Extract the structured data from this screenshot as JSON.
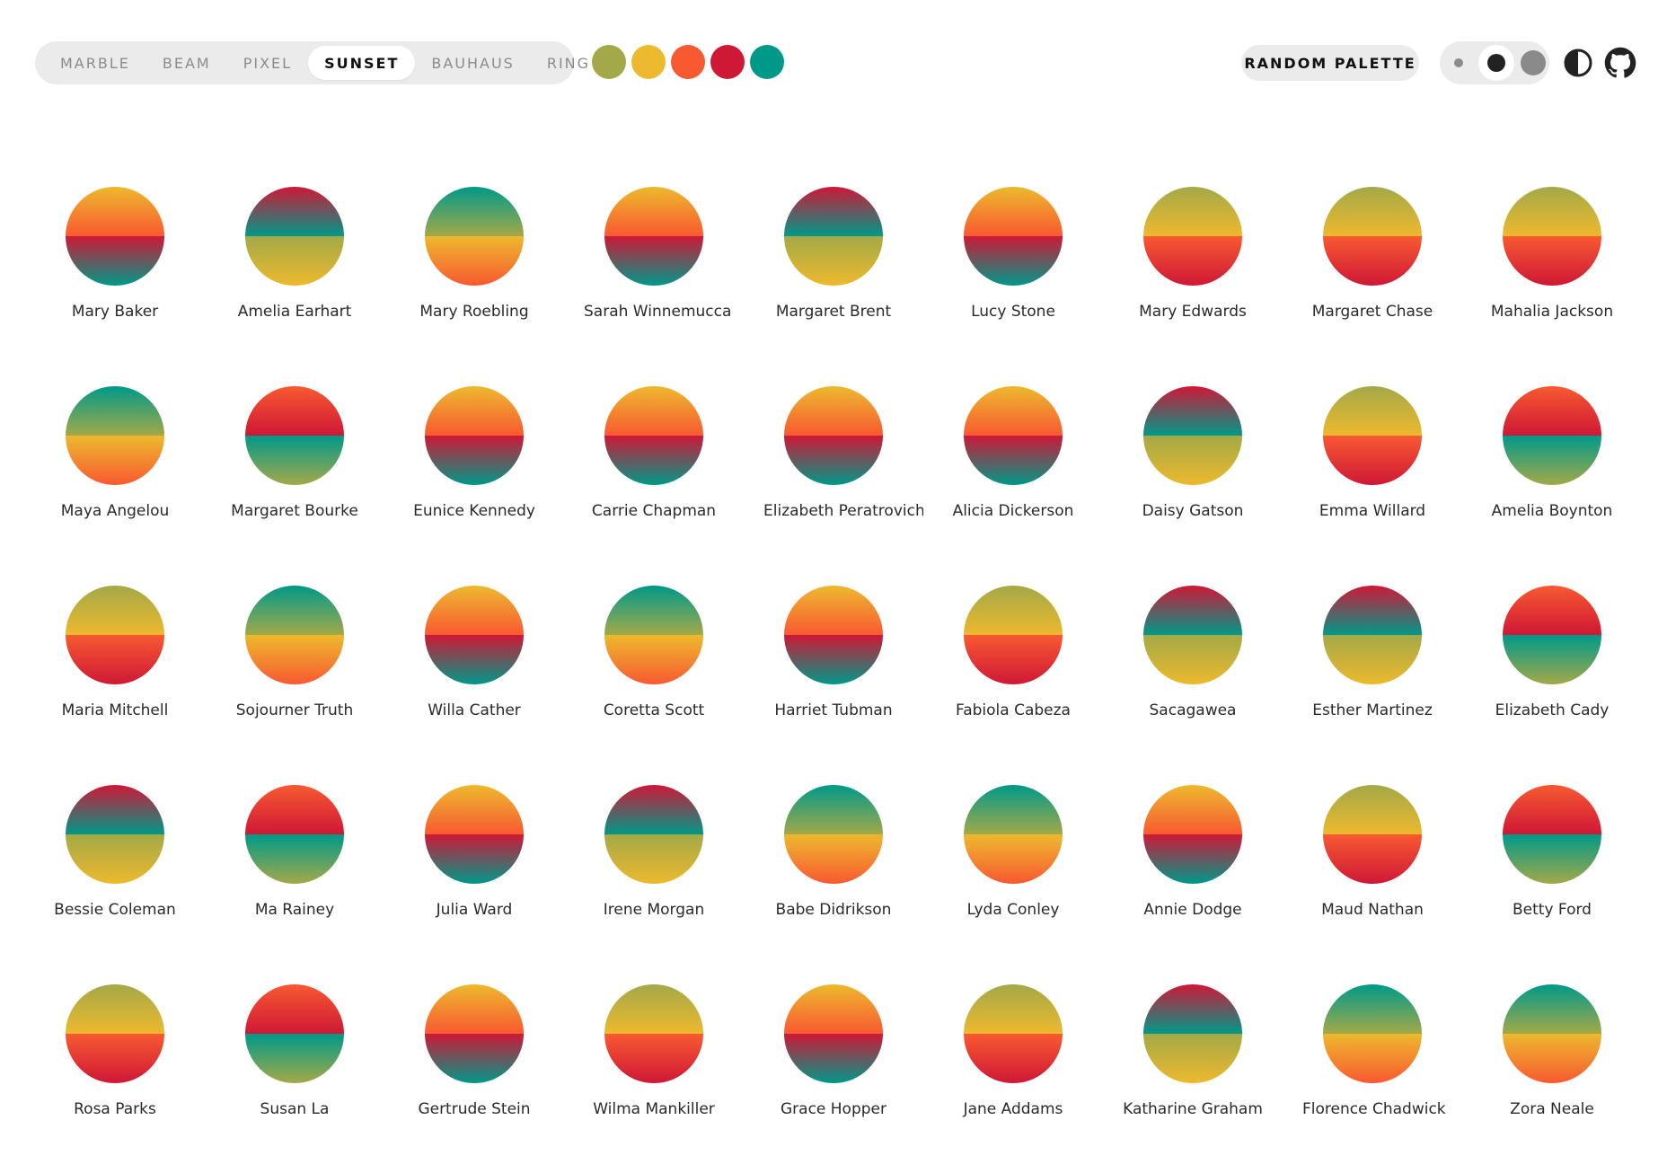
{
  "variants": [
    {
      "label": "MARBLE",
      "active": false
    },
    {
      "label": "BEAM",
      "active": false
    },
    {
      "label": "PIXEL",
      "active": false
    },
    {
      "label": "SUNSET",
      "active": true
    },
    {
      "label": "BAUHAUS",
      "active": false
    },
    {
      "label": "RING",
      "active": false
    }
  ],
  "palette": [
    "#a3a948",
    "#edb92e",
    "#f85931",
    "#ce1836",
    "#009989"
  ],
  "random_label": "RANDOM PALETTE",
  "size_options": [
    "small",
    "medium",
    "large"
  ],
  "selected_size": "medium",
  "icons": {
    "contrast": "contrast-icon",
    "github": "github-icon"
  },
  "avatars": [
    {
      "name": "Mary Baker",
      "top": [
        "#edb92e",
        "#f85931"
      ],
      "bottom": [
        "#ce1836",
        "#009989"
      ]
    },
    {
      "name": "Amelia Earhart",
      "top": [
        "#ce1836",
        "#009989"
      ],
      "bottom": [
        "#a3a948",
        "#edb92e"
      ]
    },
    {
      "name": "Mary Roebling",
      "top": [
        "#009989",
        "#a3a948"
      ],
      "bottom": [
        "#edb92e",
        "#f85931"
      ]
    },
    {
      "name": "Sarah Winnemucca",
      "top": [
        "#edb92e",
        "#f85931"
      ],
      "bottom": [
        "#ce1836",
        "#009989"
      ]
    },
    {
      "name": "Margaret Brent",
      "top": [
        "#ce1836",
        "#009989"
      ],
      "bottom": [
        "#a3a948",
        "#edb92e"
      ]
    },
    {
      "name": "Lucy Stone",
      "top": [
        "#edb92e",
        "#f85931"
      ],
      "bottom": [
        "#ce1836",
        "#009989"
      ]
    },
    {
      "name": "Mary Edwards",
      "top": [
        "#a3a948",
        "#edb92e"
      ],
      "bottom": [
        "#f85931",
        "#ce1836"
      ]
    },
    {
      "name": "Margaret Chase",
      "top": [
        "#a3a948",
        "#edb92e"
      ],
      "bottom": [
        "#f85931",
        "#ce1836"
      ]
    },
    {
      "name": "Mahalia Jackson",
      "top": [
        "#a3a948",
        "#edb92e"
      ],
      "bottom": [
        "#f85931",
        "#ce1836"
      ]
    },
    {
      "name": "Maya Angelou",
      "top": [
        "#009989",
        "#a3a948"
      ],
      "bottom": [
        "#edb92e",
        "#f85931"
      ]
    },
    {
      "name": "Margaret Bourke",
      "top": [
        "#f85931",
        "#ce1836"
      ],
      "bottom": [
        "#009989",
        "#a3a948"
      ]
    },
    {
      "name": "Eunice Kennedy",
      "top": [
        "#edb92e",
        "#f85931"
      ],
      "bottom": [
        "#ce1836",
        "#009989"
      ]
    },
    {
      "name": "Carrie Chapman",
      "top": [
        "#edb92e",
        "#f85931"
      ],
      "bottom": [
        "#ce1836",
        "#009989"
      ]
    },
    {
      "name": "Elizabeth Peratrovich",
      "top": [
        "#edb92e",
        "#f85931"
      ],
      "bottom": [
        "#ce1836",
        "#009989"
      ]
    },
    {
      "name": "Alicia Dickerson",
      "top": [
        "#edb92e",
        "#f85931"
      ],
      "bottom": [
        "#ce1836",
        "#009989"
      ]
    },
    {
      "name": "Daisy Gatson",
      "top": [
        "#ce1836",
        "#009989"
      ],
      "bottom": [
        "#a3a948",
        "#edb92e"
      ]
    },
    {
      "name": "Emma Willard",
      "top": [
        "#a3a948",
        "#edb92e"
      ],
      "bottom": [
        "#f85931",
        "#ce1836"
      ]
    },
    {
      "name": "Amelia Boynton",
      "top": [
        "#f85931",
        "#ce1836"
      ],
      "bottom": [
        "#009989",
        "#a3a948"
      ]
    },
    {
      "name": "Maria Mitchell",
      "top": [
        "#a3a948",
        "#edb92e"
      ],
      "bottom": [
        "#f85931",
        "#ce1836"
      ]
    },
    {
      "name": "Sojourner Truth",
      "top": [
        "#009989",
        "#a3a948"
      ],
      "bottom": [
        "#edb92e",
        "#f85931"
      ]
    },
    {
      "name": "Willa Cather",
      "top": [
        "#edb92e",
        "#f85931"
      ],
      "bottom": [
        "#ce1836",
        "#009989"
      ]
    },
    {
      "name": "Coretta Scott",
      "top": [
        "#009989",
        "#a3a948"
      ],
      "bottom": [
        "#edb92e",
        "#f85931"
      ]
    },
    {
      "name": "Harriet Tubman",
      "top": [
        "#edb92e",
        "#f85931"
      ],
      "bottom": [
        "#ce1836",
        "#009989"
      ]
    },
    {
      "name": "Fabiola Cabeza",
      "top": [
        "#a3a948",
        "#edb92e"
      ],
      "bottom": [
        "#f85931",
        "#ce1836"
      ]
    },
    {
      "name": "Sacagawea",
      "top": [
        "#ce1836",
        "#009989"
      ],
      "bottom": [
        "#a3a948",
        "#edb92e"
      ]
    },
    {
      "name": "Esther Martinez",
      "top": [
        "#ce1836",
        "#009989"
      ],
      "bottom": [
        "#a3a948",
        "#edb92e"
      ]
    },
    {
      "name": "Elizabeth Cady",
      "top": [
        "#f85931",
        "#ce1836"
      ],
      "bottom": [
        "#009989",
        "#a3a948"
      ]
    },
    {
      "name": "Bessie Coleman",
      "top": [
        "#ce1836",
        "#009989"
      ],
      "bottom": [
        "#a3a948",
        "#edb92e"
      ]
    },
    {
      "name": "Ma Rainey",
      "top": [
        "#f85931",
        "#ce1836"
      ],
      "bottom": [
        "#009989",
        "#a3a948"
      ]
    },
    {
      "name": "Julia Ward",
      "top": [
        "#edb92e",
        "#f85931"
      ],
      "bottom": [
        "#ce1836",
        "#009989"
      ]
    },
    {
      "name": "Irene Morgan",
      "top": [
        "#ce1836",
        "#009989"
      ],
      "bottom": [
        "#a3a948",
        "#edb92e"
      ]
    },
    {
      "name": "Babe Didrikson",
      "top": [
        "#009989",
        "#a3a948"
      ],
      "bottom": [
        "#edb92e",
        "#f85931"
      ]
    },
    {
      "name": "Lyda Conley",
      "top": [
        "#009989",
        "#a3a948"
      ],
      "bottom": [
        "#edb92e",
        "#f85931"
      ]
    },
    {
      "name": "Annie Dodge",
      "top": [
        "#edb92e",
        "#f85931"
      ],
      "bottom": [
        "#ce1836",
        "#009989"
      ]
    },
    {
      "name": "Maud Nathan",
      "top": [
        "#a3a948",
        "#edb92e"
      ],
      "bottom": [
        "#f85931",
        "#ce1836"
      ]
    },
    {
      "name": "Betty Ford",
      "top": [
        "#f85931",
        "#ce1836"
      ],
      "bottom": [
        "#009989",
        "#a3a948"
      ]
    },
    {
      "name": "Rosa Parks",
      "top": [
        "#a3a948",
        "#edb92e"
      ],
      "bottom": [
        "#f85931",
        "#ce1836"
      ]
    },
    {
      "name": "Susan La",
      "top": [
        "#f85931",
        "#ce1836"
      ],
      "bottom": [
        "#009989",
        "#a3a948"
      ]
    },
    {
      "name": "Gertrude Stein",
      "top": [
        "#edb92e",
        "#f85931"
      ],
      "bottom": [
        "#ce1836",
        "#009989"
      ]
    },
    {
      "name": "Wilma Mankiller",
      "top": [
        "#a3a948",
        "#edb92e"
      ],
      "bottom": [
        "#f85931",
        "#ce1836"
      ]
    },
    {
      "name": "Grace Hopper",
      "top": [
        "#edb92e",
        "#f85931"
      ],
      "bottom": [
        "#ce1836",
        "#009989"
      ]
    },
    {
      "name": "Jane Addams",
      "top": [
        "#a3a948",
        "#edb92e"
      ],
      "bottom": [
        "#f85931",
        "#ce1836"
      ]
    },
    {
      "name": "Katharine Graham",
      "top": [
        "#ce1836",
        "#009989"
      ],
      "bottom": [
        "#a3a948",
        "#edb92e"
      ]
    },
    {
      "name": "Florence Chadwick",
      "top": [
        "#009989",
        "#a3a948"
      ],
      "bottom": [
        "#edb92e",
        "#f85931"
      ]
    },
    {
      "name": "Zora Neale",
      "top": [
        "#009989",
        "#a3a948"
      ],
      "bottom": [
        "#edb92e",
        "#f85931"
      ]
    }
  ]
}
